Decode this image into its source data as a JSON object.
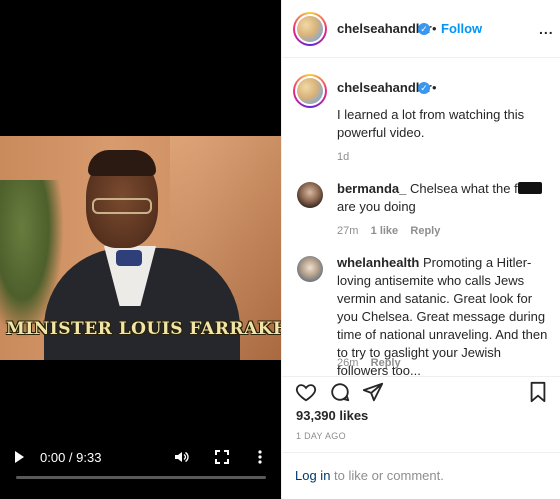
{
  "video": {
    "caption": "MINISTER LOUIS FARRAKHAN",
    "time": "0:00 / 9:33",
    "progress_fraction": 0.0
  },
  "header": {
    "username": "chelseahandler",
    "separator": "•",
    "follow_label": "Follow",
    "menu_label": "..."
  },
  "post": {
    "username": "chelseahandler",
    "separator": "•",
    "text": "I learned a lot from watching this powerful video.",
    "age": "1d"
  },
  "comments": [
    {
      "username": "bermanda_",
      "text_before": "Chelsea what the f",
      "text_after": "are you doing",
      "age": "27m",
      "likes": "1 like",
      "reply": "Reply"
    },
    {
      "username": "whelanhealth",
      "text": "Promoting a Hitler-loving antisemite who calls Jews vermin and satanic. Great look for you Chelsea. Great message during time of national unraveling. And then to try to gaslight your Jewish followers too...",
      "age": "26m",
      "reply": "Reply"
    }
  ],
  "actions": {
    "likes": "93,390 likes",
    "posted": "1 DAY AGO"
  },
  "login": {
    "link": "Log in",
    "rest": " to like or comment."
  },
  "colors": {
    "accent": "#0095f6",
    "verified": "#3897f0",
    "muted": "#8e8e8e"
  }
}
